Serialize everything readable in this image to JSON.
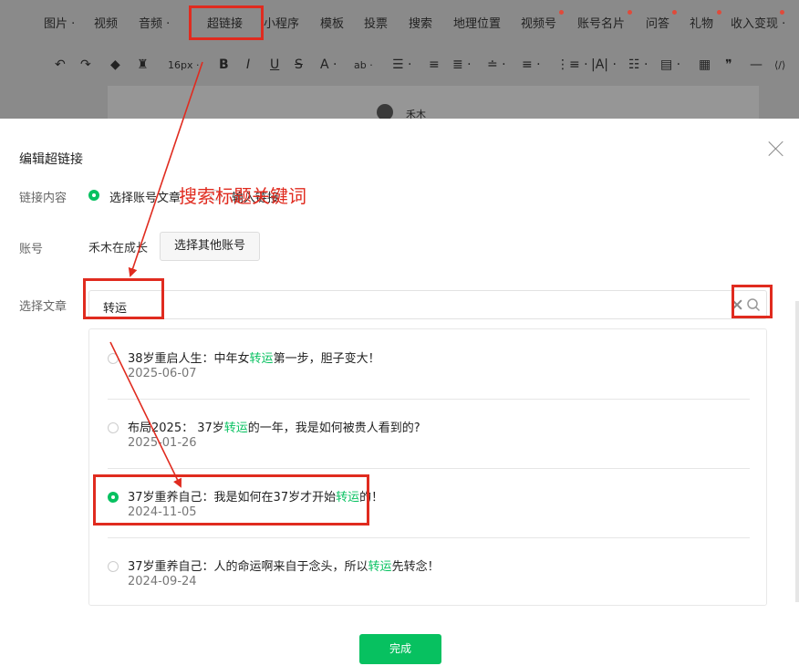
{
  "menu": {
    "items": [
      {
        "label": "图片 ·",
        "dot": false
      },
      {
        "label": "视频",
        "dot": false
      },
      {
        "label": "音频 ·",
        "dot": false
      },
      {
        "label": "超链接",
        "dot": false
      },
      {
        "label": "小程序",
        "dot": false
      },
      {
        "label": "模板",
        "dot": false
      },
      {
        "label": "投票",
        "dot": false
      },
      {
        "label": "搜索",
        "dot": false
      },
      {
        "label": "地理位置",
        "dot": false
      },
      {
        "label": "视频号",
        "dot": true
      },
      {
        "label": "账号名片",
        "dot": true
      },
      {
        "label": "问答",
        "dot": true
      },
      {
        "label": "礼物",
        "dot": true
      },
      {
        "label": "收入变现 ·",
        "dot": true
      }
    ]
  },
  "toolbar": {
    "font_size": "16px ·",
    "icons": [
      "undo-icon",
      "redo-icon",
      "format-brush-icon",
      "clear-format-icon",
      "bold-icon",
      "italic-icon",
      "underline-icon",
      "strikethrough-icon",
      "font-color-icon",
      "background-color-icon",
      "align-icon",
      "indent-icon",
      "line-spacing-icon",
      "paragraph-spacing-icon",
      "list-icon",
      "table-icon",
      "quote-icon",
      "divider-icon",
      "code-icon"
    ],
    "glyphs": [
      "↶",
      "↷",
      "◆",
      "♜",
      "B",
      "I",
      "U",
      "S",
      "A ·",
      "ab ·",
      "☰ ·",
      "≡",
      "≣ ·",
      "≐ ·",
      "≡ ·",
      "⋮≡ ·",
      "|A| ·",
      "☷ ·",
      "▤ ·",
      "▦",
      "❞",
      "—",
      "⟨/⟩"
    ]
  },
  "editor": {
    "author": "禾木"
  },
  "dialog": {
    "title": "编辑超链接",
    "link_content_label": "链接内容",
    "option_article": "选择账号文章",
    "option_link": "输入链接",
    "account_label": "账号",
    "account_name": "禾木在成长",
    "other_account_button": "选择其他账号",
    "select_article_label": "选择文章",
    "search_value": "转运",
    "results": [
      {
        "before": "38岁重启人生：中年女",
        "highlight": "转运",
        "after": "第一步，胆子变大！",
        "date": "2025-06-07",
        "selected": false
      },
      {
        "before": "布局2025： 37岁",
        "highlight": "转运",
        "after": "的一年，我是如何被贵人看到的?",
        "date": "2025-01-26",
        "selected": false
      },
      {
        "before": "37岁重养自己：我是如何在37岁才开始",
        "highlight": "转运",
        "after": "的！",
        "date": "2024-11-05",
        "selected": true
      },
      {
        "before": "37岁重养自己：人的命运啊来自于念头，所以",
        "highlight": "转运",
        "after": "先转念！",
        "date": "2024-09-24",
        "selected": false
      }
    ],
    "done_button": "完成"
  },
  "annotation": {
    "text": "搜索标题关键词",
    "color": "#e02b1f"
  },
  "colors": {
    "accent": "#07c160",
    "annotation": "#e02b1f",
    "overlay": "#8a8a8a"
  }
}
